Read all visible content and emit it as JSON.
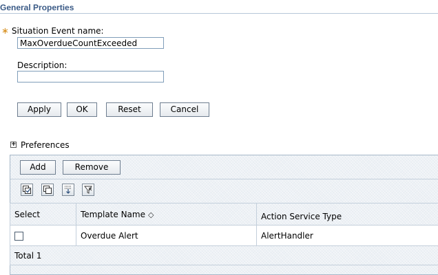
{
  "section": {
    "title": "General Properties"
  },
  "form": {
    "name_required_marker": "∗",
    "name_label": "Situation Event name:",
    "name_value": "MaxOverdueCountExceeded",
    "description_label": "Description:",
    "description_value": ""
  },
  "actions": {
    "apply": "Apply",
    "ok": "OK",
    "reset": "Reset",
    "cancel": "Cancel"
  },
  "preferences": {
    "expander": "+",
    "label": "Preferences"
  },
  "collection": {
    "add": "Add",
    "remove": "Remove",
    "icons": [
      "select-all-icon",
      "deselect-all-icon",
      "show-filter-icon",
      "clear-filter-icon"
    ],
    "columns": {
      "select": "Select",
      "template_name": "Template Name",
      "sort_glyph": "◇",
      "action_service_type": "Action Service Type"
    },
    "rows": [
      {
        "selected": false,
        "template_name": "Overdue Alert",
        "action_service_type": "AlertHandler"
      }
    ],
    "total": "Total 1"
  },
  "colors": {
    "title_text": "#3a5a86",
    "required_star": "#d68d1a",
    "collection_bg": "#e8edf2",
    "grid_border": "#c3cfdb"
  }
}
